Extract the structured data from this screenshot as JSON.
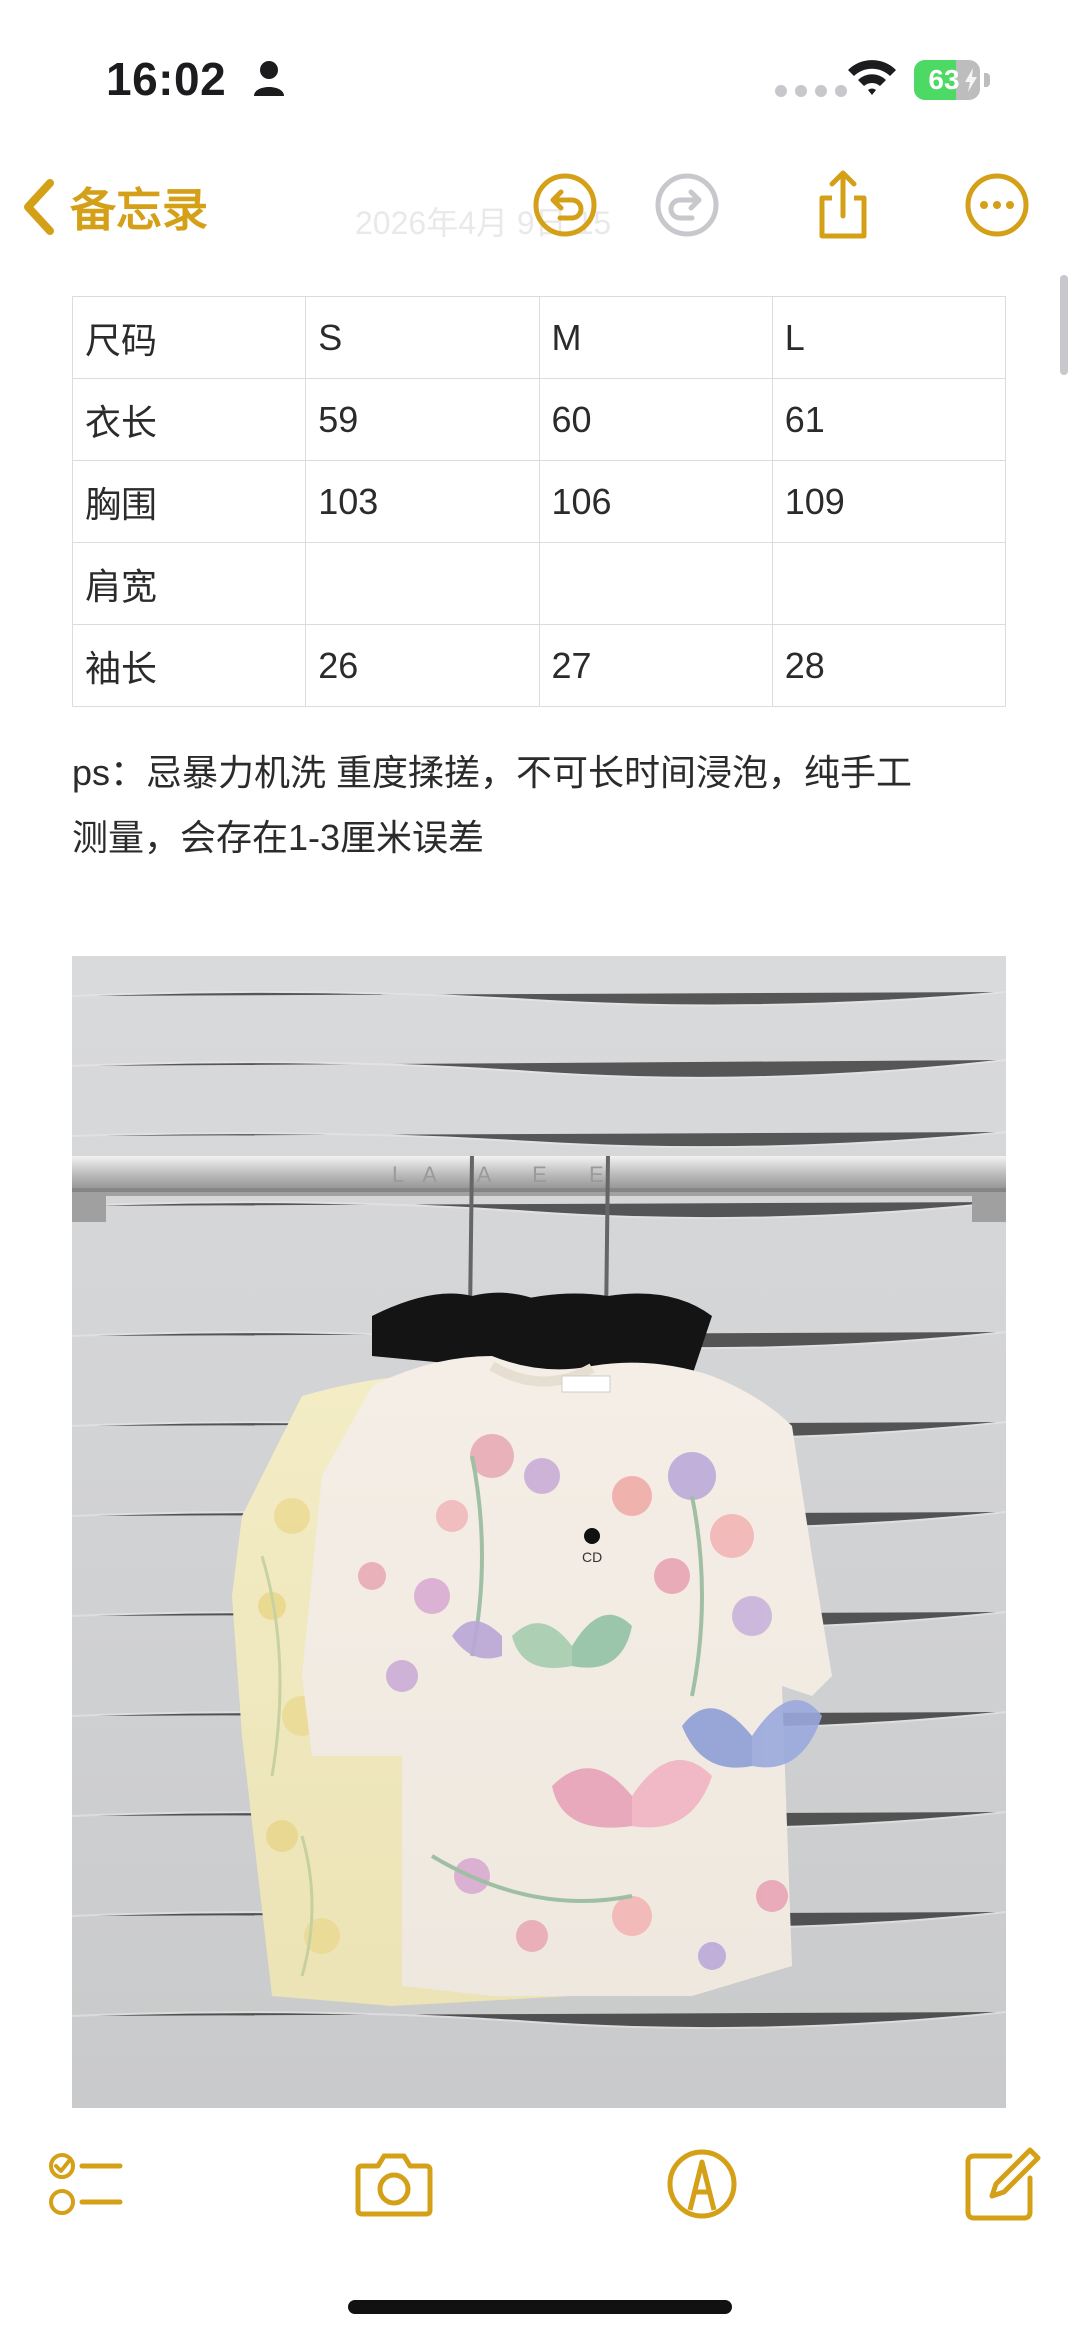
{
  "status_bar": {
    "time": "16:02",
    "battery_percent": "63",
    "battery_level": 0.63,
    "charging": true,
    "icons": [
      "person-icon",
      "signal-icon",
      "wifi-icon",
      "battery-icon"
    ]
  },
  "nav": {
    "back_label": "备忘录",
    "faint_title": "2026年4月  9日 15",
    "accent_color": "#d4a017",
    "icons": [
      "chevron-left-icon",
      "undo-icon",
      "redo-icon",
      "share-icon",
      "more-icon"
    ]
  },
  "table": {
    "rows": [
      [
        "尺码",
        "S",
        "M",
        "L"
      ],
      [
        "衣长",
        "59",
        "60",
        "61"
      ],
      [
        "胸围",
        "103",
        "106",
        "109"
      ],
      [
        "肩宽",
        "",
        "",
        ""
      ],
      [
        "袖长",
        "26",
        "27",
        "28"
      ]
    ]
  },
  "note": {
    "line1": "ps：忌暴力机洗 重度揉搓，不可长时间浸泡，纯手工",
    "line2": "测量，会存在1-3厘米误差"
  },
  "photo": {
    "description_icon": "photo-icon",
    "rail_text": "LA A E E"
  },
  "toolbar": {
    "icons": [
      "checklist-icon",
      "camera-icon",
      "markup-icon",
      "compose-icon"
    ]
  }
}
